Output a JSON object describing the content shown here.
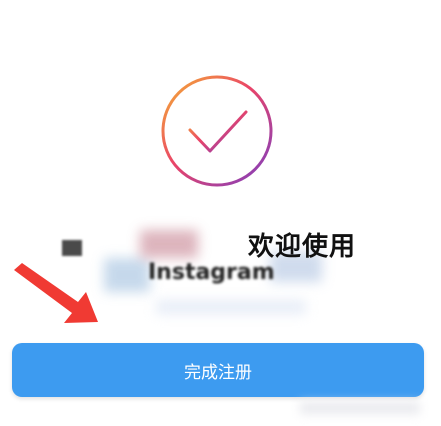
{
  "welcome": {
    "title": "欢迎使用",
    "app_name": "Instagram"
  },
  "actions": {
    "complete_label": "完成注册"
  },
  "icons": {
    "check": "checkmark-circle-icon",
    "arrow": "red-arrow-annotation"
  },
  "colors": {
    "accent_blue": "#3d9bf0",
    "arrow_red": "#f03a33",
    "gradient_orange": "#f5a623",
    "gradient_pink": "#d6246e",
    "gradient_purple": "#8a3ab9"
  }
}
